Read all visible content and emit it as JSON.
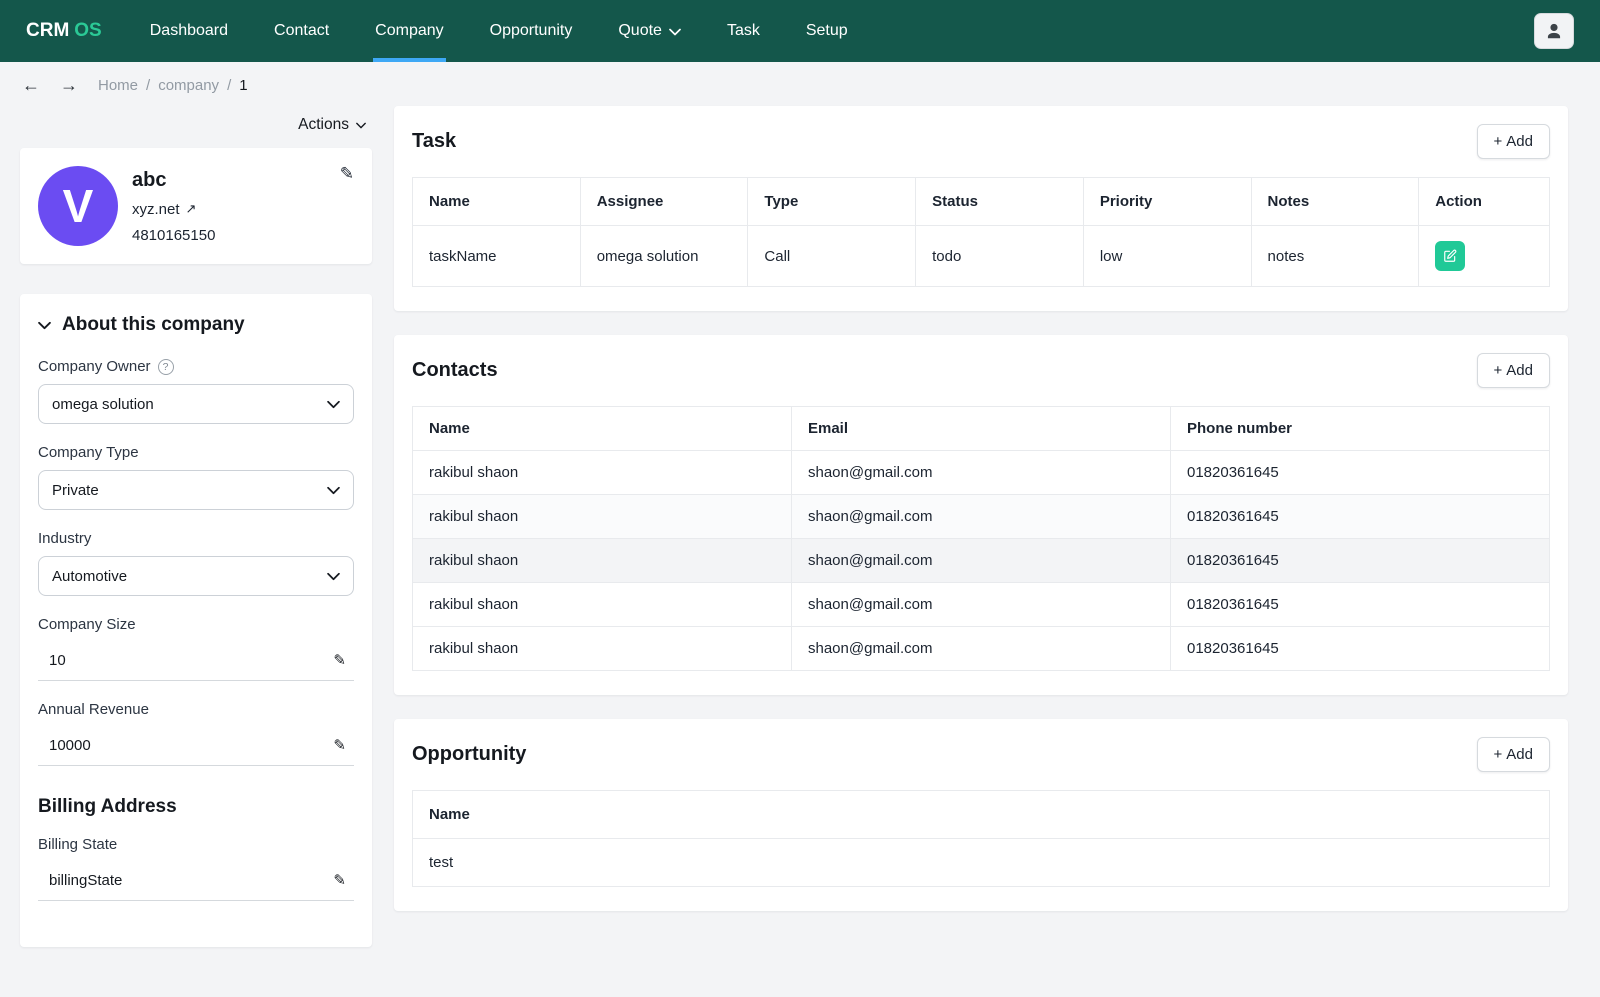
{
  "icons": {
    "back": "←",
    "forward": "→",
    "plus": "+",
    "pencil": "✎",
    "external_link": "↗",
    "help": "?"
  },
  "colors": {
    "navbar_bg": "#14574B",
    "logo_accent": "#2BC996",
    "active_tab_underline": "#3EA8F5",
    "action_button": "#20C997",
    "avatar_bg": "#6B4CF2"
  },
  "navbar": {
    "logo_part1": "CRM",
    "logo_part2": "OS",
    "items": [
      "Dashboard",
      "Contact",
      "Company",
      "Opportunity",
      "Quote",
      "Task",
      "Setup"
    ],
    "active_item": "Company"
  },
  "breadcrumb": {
    "separator": "/",
    "items": [
      "Home",
      "company",
      "1"
    ]
  },
  "sidebar": {
    "actions_label": "Actions",
    "company": {
      "avatar_letter": "V",
      "name": "abc",
      "website": "xyz.net",
      "phone": "4810165150"
    },
    "about": {
      "title": "About this company",
      "company_owner_label": "Company Owner",
      "company_owner_value": "omega solution",
      "company_type_label": "Company Type",
      "company_type_value": "Private",
      "industry_label": "Industry",
      "industry_value": "Automotive",
      "company_size_label": "Company Size",
      "company_size_value": "10",
      "annual_revenue_label": "Annual Revenue",
      "annual_revenue_value": "10000",
      "billing_title": "Billing Address",
      "billing_state_label": "Billing State",
      "billing_state_value": "billingState"
    }
  },
  "task": {
    "title": "Task",
    "add_label": "Add",
    "columns": [
      "Name",
      "Assignee",
      "Type",
      "Status",
      "Priority",
      "Notes",
      "Action"
    ],
    "rows": [
      {
        "name": "taskName",
        "assignee": "omega solution",
        "type": "Call",
        "status": "todo",
        "priority": "low",
        "notes": "notes"
      }
    ]
  },
  "contacts": {
    "title": "Contacts",
    "add_label": "Add",
    "columns": [
      "Name",
      "Email",
      "Phone number"
    ],
    "rows": [
      {
        "name": "rakibul shaon",
        "email": "shaon@gmail.com",
        "phone": "01820361645"
      },
      {
        "name": "rakibul shaon",
        "email": "shaon@gmail.com",
        "phone": "01820361645"
      },
      {
        "name": "rakibul shaon",
        "email": "shaon@gmail.com",
        "phone": "01820361645"
      },
      {
        "name": "rakibul shaon",
        "email": "shaon@gmail.com",
        "phone": "01820361645"
      },
      {
        "name": "rakibul shaon",
        "email": "shaon@gmail.com",
        "phone": "01820361645"
      }
    ]
  },
  "opportunity": {
    "title": "Opportunity",
    "add_label": "Add",
    "columns": [
      "Name"
    ],
    "rows": [
      {
        "name": "test"
      }
    ]
  }
}
